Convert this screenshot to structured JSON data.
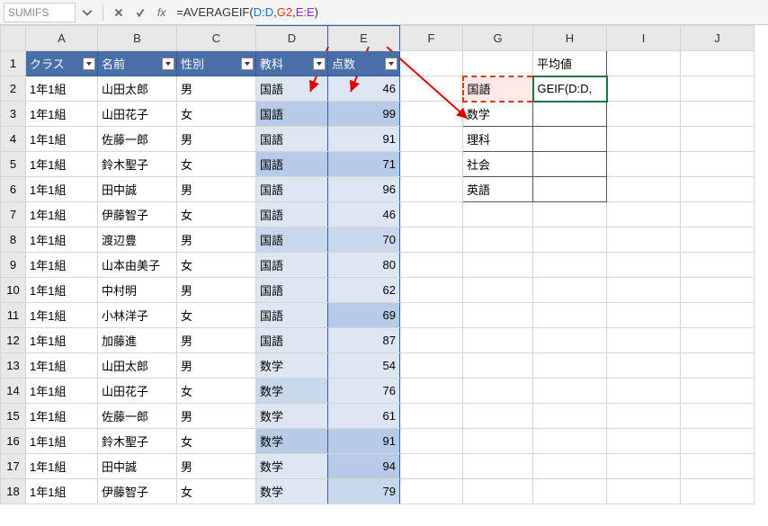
{
  "namebox": "SUMIFS",
  "formula": {
    "prefix": "=AVERAGEIF(",
    "arg1": "D:D",
    "arg2": "G2",
    "arg3": "E:E",
    "suffix": ")"
  },
  "columns": [
    "A",
    "B",
    "C",
    "D",
    "E",
    "F",
    "G",
    "H",
    "I",
    "J"
  ],
  "headers": {
    "A": "クラス",
    "B": "名前",
    "C": "性別",
    "D": "教科",
    "E": "点数"
  },
  "rows": [
    {
      "n": 1
    },
    {
      "n": 2,
      "A": "1年1組",
      "B": "山田太郎",
      "C": "男",
      "D": "国語",
      "E": 46,
      "G": "国語",
      "H": "GEIF(D:D,"
    },
    {
      "n": 3,
      "A": "1年1組",
      "B": "山田花子",
      "C": "女",
      "D": "国語",
      "E": 99,
      "G": "数学"
    },
    {
      "n": 4,
      "A": "1年1組",
      "B": "佐藤一郎",
      "C": "男",
      "D": "国語",
      "E": 91,
      "G": "理科"
    },
    {
      "n": 5,
      "A": "1年1組",
      "B": "鈴木聖子",
      "C": "女",
      "D": "国語",
      "E": 71,
      "G": "社会"
    },
    {
      "n": 6,
      "A": "1年1組",
      "B": "田中誠",
      "C": "男",
      "D": "国語",
      "E": 96,
      "G": "英語"
    },
    {
      "n": 7,
      "A": "1年1組",
      "B": "伊藤智子",
      "C": "女",
      "D": "国語",
      "E": 46
    },
    {
      "n": 8,
      "A": "1年1組",
      "B": "渡辺豊",
      "C": "男",
      "D": "国語",
      "E": 70
    },
    {
      "n": 9,
      "A": "1年1組",
      "B": "山本由美子",
      "C": "女",
      "D": "国語",
      "E": 80
    },
    {
      "n": 10,
      "A": "1年1組",
      "B": "中村明",
      "C": "男",
      "D": "国語",
      "E": 62
    },
    {
      "n": 11,
      "A": "1年1組",
      "B": "小林洋子",
      "C": "女",
      "D": "国語",
      "E": 69
    },
    {
      "n": 12,
      "A": "1年1組",
      "B": "加藤進",
      "C": "男",
      "D": "国語",
      "E": 87
    },
    {
      "n": 13,
      "A": "1年1組",
      "B": "山田太郎",
      "C": "男",
      "D": "数学",
      "E": 54
    },
    {
      "n": 14,
      "A": "1年1組",
      "B": "山田花子",
      "C": "女",
      "D": "数学",
      "E": 76
    },
    {
      "n": 15,
      "A": "1年1組",
      "B": "佐藤一郎",
      "C": "男",
      "D": "数学",
      "E": 61
    },
    {
      "n": 16,
      "A": "1年1組",
      "B": "鈴木聖子",
      "C": "女",
      "D": "数学",
      "E": 91
    },
    {
      "n": 17,
      "A": "1年1組",
      "B": "田中誠",
      "C": "男",
      "D": "数学",
      "E": 94
    },
    {
      "n": 18,
      "A": "1年1組",
      "B": "伊藤智子",
      "C": "女",
      "D": "数学",
      "E": 79
    }
  ],
  "summary_header": "平均値",
  "subjects": [
    "国語",
    "数学",
    "理科",
    "社会",
    "英語"
  ]
}
